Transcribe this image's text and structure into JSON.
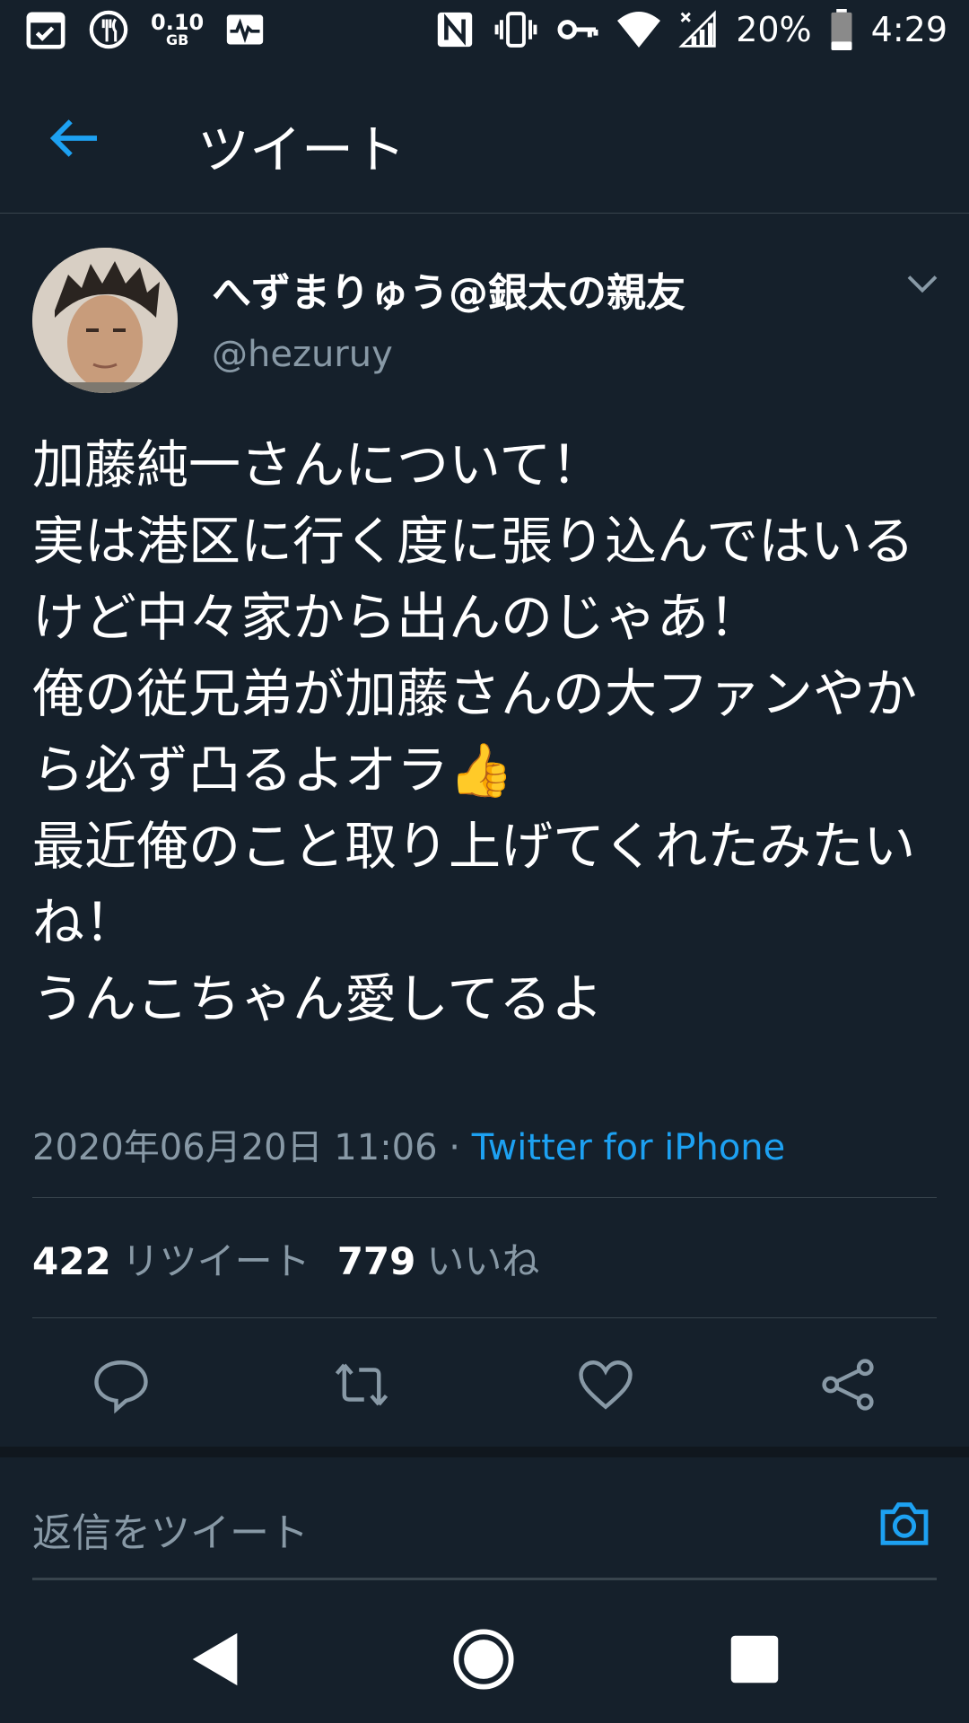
{
  "status_bar": {
    "data_amount": "0.10",
    "data_unit": "GB",
    "battery": "20%",
    "time": "4:29",
    "icons": [
      "calendar-check-icon",
      "restaurant-icon",
      "data-usage-icon",
      "activity-icon",
      "nfc-icon",
      "vibrate-icon",
      "vpn-key-icon",
      "wifi-icon",
      "cell-signal-icon",
      "battery-icon"
    ]
  },
  "header": {
    "title": "ツイート",
    "back_icon": "arrow-left-icon",
    "accent": "#1da1f2"
  },
  "tweet": {
    "author_name": "へずまりゅう@銀太の親友",
    "author_handle": "@hezuruy",
    "text": "加藤純一さんについて！\n実は港区に行く度に張り込んではいるけど中々家から出んのじゃあ！\n俺の従兄弟が加藤さんの大ファンやから必ず凸るよオラ👍\n最近俺のこと取り上げてくれたみたいね！\nうんこちゃん愛してるよ",
    "timestamp": "2020年06月20日 11:06",
    "separator": " · ",
    "source": "Twitter for iPhone",
    "retweet_count": "422",
    "retweet_label": "リツイート",
    "like_count": "779",
    "like_label": "いいね"
  },
  "actions": [
    "reply-icon",
    "retweet-icon",
    "like-icon",
    "share-icon"
  ],
  "reply": {
    "placeholder": "返信をツイート",
    "camera_icon": "camera-icon"
  },
  "navbar": [
    "back-triangle-icon",
    "home-circle-icon",
    "recents-square-icon"
  ],
  "colors": {
    "background": "#15202b",
    "secondary_text": "#8899a6",
    "divider": "#38444d",
    "link": "#1da1f2"
  }
}
